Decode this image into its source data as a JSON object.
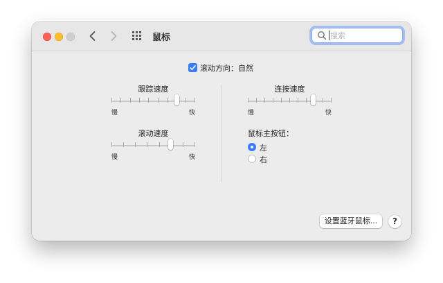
{
  "window": {
    "title": "鼠标"
  },
  "toolbar": {
    "back_icon": "chevron-left-icon",
    "forward_icon": "chevron-right-icon",
    "grid_icon": "grid-icon",
    "search": {
      "placeholder": "搜索",
      "value": ""
    }
  },
  "scroll_direction": {
    "label": "滚动方向：自然",
    "checked": true
  },
  "tracking_speed": {
    "title": "跟踪速度",
    "min_label": "慢",
    "max_label": "快",
    "ticks": 10,
    "value_fraction": 0.78
  },
  "double_click_speed": {
    "title": "连按速度",
    "min_label": "慢",
    "max_label": "快",
    "ticks": 11,
    "value_fraction": 0.78
  },
  "scrolling_speed": {
    "title": "滚动速度",
    "min_label": "慢",
    "max_label": "快",
    "ticks": 8,
    "value_fraction": 0.71
  },
  "primary_button": {
    "title": "鼠标主按钮：",
    "options": [
      {
        "label": "左",
        "selected": true
      },
      {
        "label": "右",
        "selected": false
      }
    ]
  },
  "bluetooth_button": {
    "label": "设置蓝牙鼠标..."
  },
  "help_button": {
    "label": "?"
  },
  "colors": {
    "accent": "#3a7bf6",
    "close": "#fe5f57",
    "minimize": "#febc2e",
    "zoom_inactive": "#cfcfcf"
  }
}
